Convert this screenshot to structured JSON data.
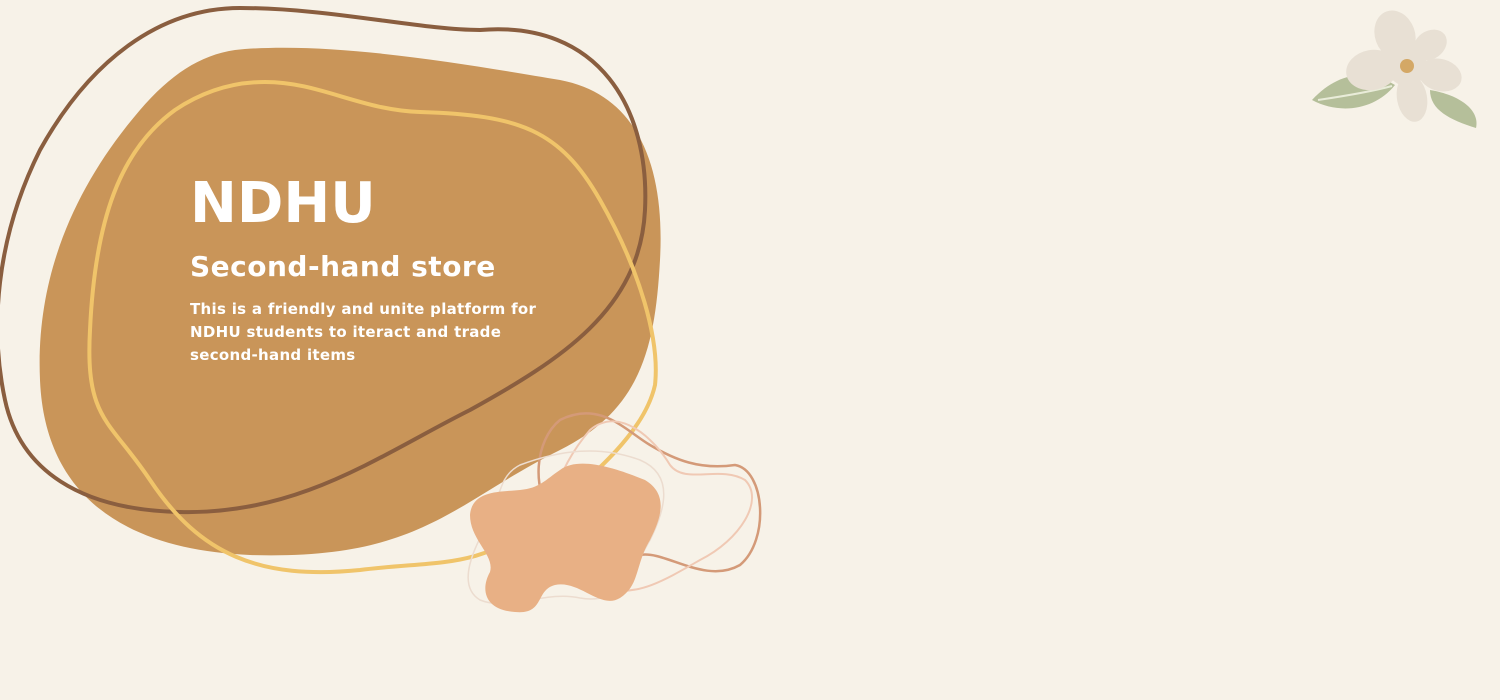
{
  "hero": {
    "title": "NDHU",
    "subtitle": "Second-hand store",
    "description": "This is a friendly and unite platform for NDHU students to iteract and trade second-hand items"
  },
  "decorations": {
    "icons": [
      "blob-shape",
      "outline-blob",
      "flower-icon",
      "leaf-icon",
      "small-blob-shape"
    ]
  },
  "colors": {
    "background": "#f7f2e8",
    "main_blob": "#c99559",
    "brown_outline": "#8a5e3f",
    "yellow_outline": "#f0c46a",
    "peach_blob": "#e8b085",
    "flower_petal": "#e8e0d4",
    "flower_center": "#d4a866",
    "leaf": "#b5bf9a"
  }
}
